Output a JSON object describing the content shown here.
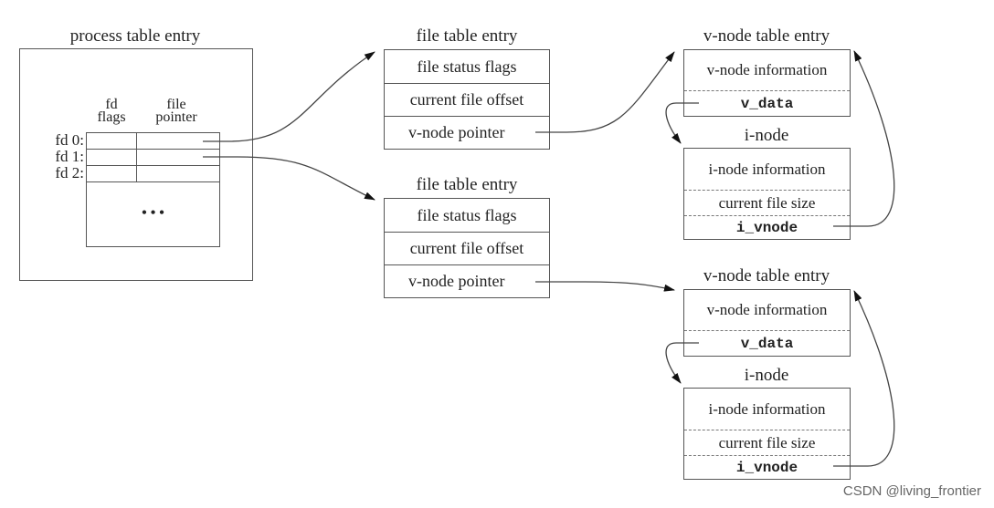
{
  "process": {
    "title": "process table entry",
    "col_fd_flags": [
      "fd",
      "flags"
    ],
    "col_file_pointer": [
      "file",
      "pointer"
    ],
    "rows": [
      "fd 0:",
      "fd 1:",
      "fd 2:"
    ],
    "ellipsis": "• • •"
  },
  "file_tables": [
    {
      "title": "file table entry",
      "rows": [
        "file status flags",
        "current file offset",
        "v-node pointer"
      ]
    },
    {
      "title": "file table entry",
      "rows": [
        "file status flags",
        "current file offset",
        "v-node pointer"
      ]
    }
  ],
  "vnodes": [
    {
      "title": "v-node table entry",
      "info": "v-node information",
      "ptr": "v_data",
      "inode_title": "i-node",
      "inode_rows": [
        "i-node information",
        "current file size",
        "i_vnode"
      ]
    },
    {
      "title": "v-node table entry",
      "info": "v-node information",
      "ptr": "v_data",
      "inode_title": "i-node",
      "inode_rows": [
        "i-node information",
        "current file size",
        "i_vnode"
      ]
    }
  ],
  "watermark": "CSDN @living_frontier"
}
